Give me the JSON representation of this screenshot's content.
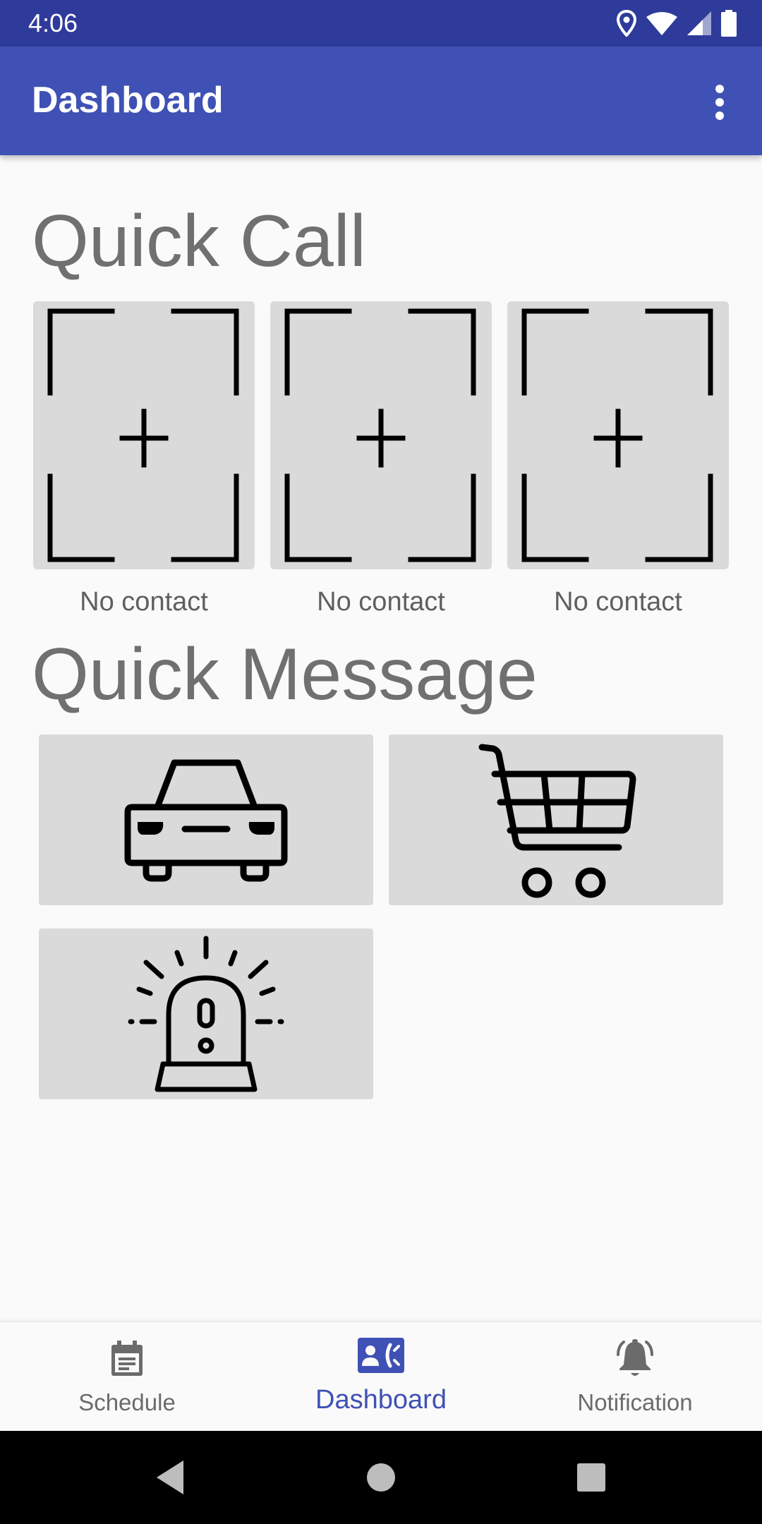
{
  "status_bar": {
    "time": "4:06",
    "icons": [
      "location-icon",
      "wifi-icon",
      "signal-icon",
      "battery-icon"
    ]
  },
  "app_bar": {
    "title": "Dashboard",
    "menu_icon": "more-vert-icon"
  },
  "quick_call": {
    "title": "Quick Call",
    "contacts": [
      {
        "label": "No contact",
        "icon": "add-contact-icon"
      },
      {
        "label": "No contact",
        "icon": "add-contact-icon"
      },
      {
        "label": "No contact",
        "icon": "add-contact-icon"
      }
    ]
  },
  "quick_message": {
    "title": "Quick Message",
    "tiles": [
      {
        "icon": "car-icon"
      },
      {
        "icon": "shopping-cart-icon"
      },
      {
        "icon": "siren-icon"
      }
    ]
  },
  "bottom_nav": {
    "items": [
      {
        "label": "Schedule",
        "icon": "calendar-icon",
        "active": false
      },
      {
        "label": "Dashboard",
        "icon": "contact-phone-icon",
        "active": true
      },
      {
        "label": "Notification",
        "icon": "bell-icon",
        "active": false
      }
    ]
  },
  "system_nav": {
    "buttons": [
      "back-icon",
      "home-icon",
      "recents-icon"
    ]
  },
  "colors": {
    "status_bar": "#2f3b9a",
    "primary": "#3f51b5",
    "card_bg": "#d9dad9",
    "heading_text": "#707070",
    "inactive_nav": "#6b6b6b"
  }
}
